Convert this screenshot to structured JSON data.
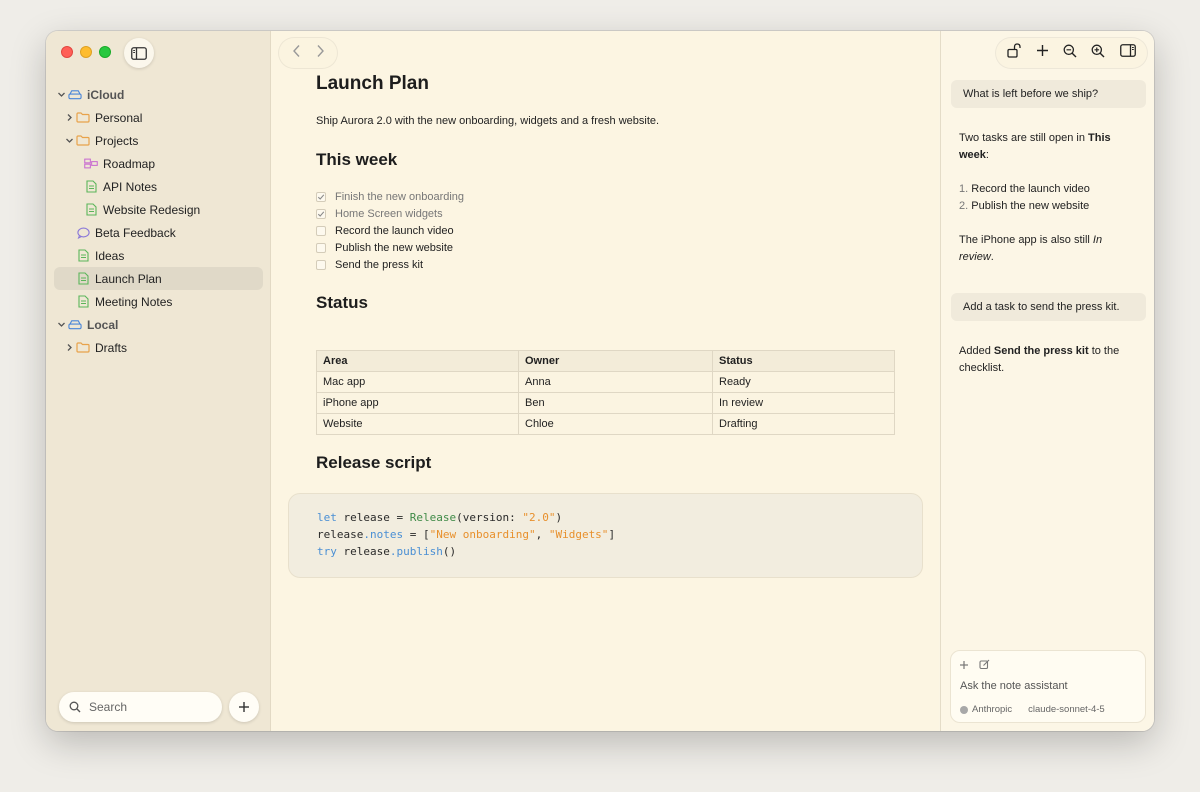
{
  "sidebar": {
    "tree": [
      {
        "label": "iCloud",
        "kind": "group",
        "icon": "cloud-drive-icon",
        "chevron": "down"
      },
      {
        "label": "Personal",
        "kind": "folder",
        "icon": "folder-icon",
        "chevron": "right"
      },
      {
        "label": "Projects",
        "kind": "folder",
        "icon": "folder-icon",
        "chevron": "down"
      },
      {
        "label": "Roadmap",
        "kind": "canvas",
        "icon": "roadmap-icon"
      },
      {
        "label": "API Notes",
        "kind": "note",
        "icon": "note-icon"
      },
      {
        "label": "Website Redesign",
        "kind": "note",
        "icon": "note-icon"
      },
      {
        "label": "Beta Feedback",
        "kind": "chat",
        "icon": "chat-bubble-icon"
      },
      {
        "label": "Ideas",
        "kind": "note",
        "icon": "note-icon"
      },
      {
        "label": "Launch Plan",
        "kind": "note",
        "icon": "note-icon",
        "selected": true
      },
      {
        "label": "Meeting Notes",
        "kind": "note",
        "icon": "note-icon"
      },
      {
        "label": "Local",
        "kind": "group",
        "icon": "local-drive-icon",
        "chevron": "down"
      },
      {
        "label": "Drafts",
        "kind": "folder",
        "icon": "folder-icon",
        "chevron": "right"
      }
    ],
    "search_placeholder": "Search"
  },
  "doc": {
    "title": "Launch Plan",
    "intro": "Ship Aurora 2.0 with the new onboarding, widgets and a fresh website.",
    "this_week": "This week",
    "tasks": [
      {
        "text": "Finish the new onboarding",
        "done": true
      },
      {
        "text": "Home Screen widgets",
        "done": true
      },
      {
        "text": "Record the launch video",
        "done": false
      },
      {
        "text": "Publish the new website",
        "done": false
      },
      {
        "text": "Send the press kit",
        "done": false
      }
    ],
    "status_heading": "Status",
    "table": {
      "headers": [
        "Area",
        "Owner",
        "Status"
      ],
      "rows": [
        [
          "Mac app",
          "Anna",
          "Ready"
        ],
        [
          "iPhone app",
          "Ben",
          "In review"
        ],
        [
          "Website",
          "Chloe",
          "Drafting"
        ]
      ]
    },
    "release_heading": "Release script",
    "code": {
      "l1": {
        "kw": "let",
        "a": " release = ",
        "type": "Release",
        "b": "(version: ",
        "s1": "\"2.0\"",
        "c": ")"
      },
      "l2": {
        "a": "release",
        "prop": ".notes",
        "b": " = [",
        "s1": "\"New onboarding\"",
        "c": ", ",
        "s2": "\"Widgets\"",
        "d": "]"
      },
      "l3": {
        "kw": "try",
        "a": " release",
        "prop": ".publish",
        "b": "()"
      }
    }
  },
  "assistant": {
    "q1": "What is left before we ship?",
    "a1": {
      "p1_pre": "Two tasks are still open in ",
      "p1_bold": "This week",
      "p1_post": ":",
      "items": [
        {
          "num": "1.",
          "text": "Record the launch video"
        },
        {
          "num": "2.",
          "text": "Publish the new website"
        }
      ],
      "p2_pre": "The iPhone app is also still ",
      "p2_em": "In review",
      "p2_post": "."
    },
    "q2": "Add a task to send the press kit.",
    "a2": {
      "pre": "Added ",
      "bold": "Send the press kit",
      "post": " to the checklist."
    },
    "composer_placeholder": "Ask the note assistant",
    "provider": "Anthropic",
    "model": "claude-sonnet-4-5"
  },
  "colors": {
    "folder": "#e8a24a",
    "note": "#5bb55a",
    "drive": "#4a86d8",
    "chat": "#8a78d8",
    "roadmap": "#c86ad0",
    "keyword": "#4a8fd4",
    "type": "#3f8a47",
    "string": "#e8902c"
  }
}
